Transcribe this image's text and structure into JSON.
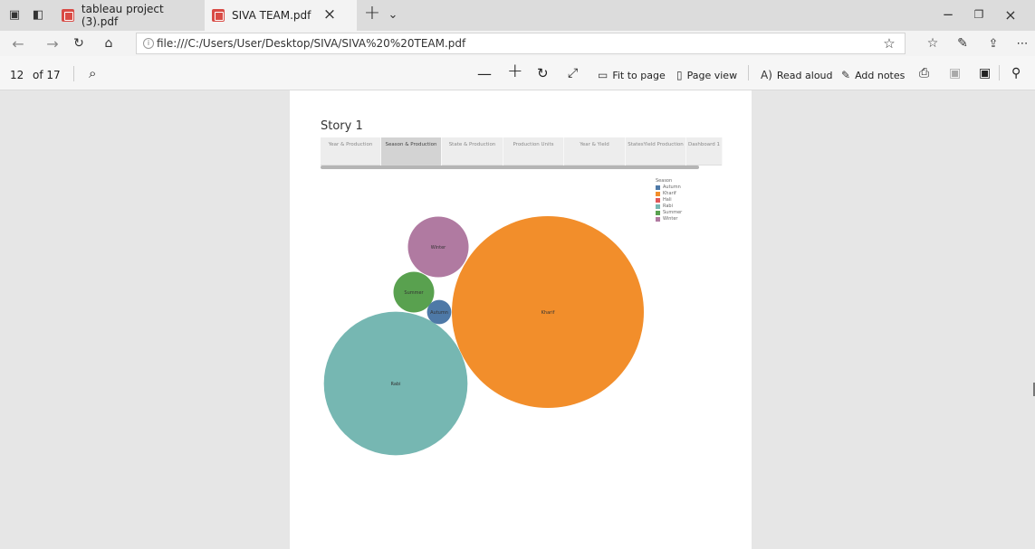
{
  "browser": {
    "tabs": [
      {
        "label": "tableau project (3).pdf"
      },
      {
        "label": "SIVA TEAM.pdf"
      }
    ],
    "url": "file:///C:/Users/User/Desktop/SIVA/SIVA%20%20TEAM.pdf"
  },
  "pdf_toolbar": {
    "page_current": "12",
    "page_total": "of 17",
    "fit_to_page": "Fit to page",
    "page_view": "Page view",
    "read_aloud": "Read aloud",
    "add_notes": "Add notes"
  },
  "story": {
    "title": "Story 1",
    "tabs": [
      "Year & Production",
      "Season & Production",
      "State & Production",
      "Production Units",
      "Year & Yield",
      "StatesYield Production",
      "Dashboard 1"
    ]
  },
  "legend": {
    "title": "Season",
    "items": [
      {
        "name": "Autumn",
        "color": "#4e79a7"
      },
      {
        "name": "Kharif",
        "color": "#f28e2b"
      },
      {
        "name": "Hali",
        "color": "#e15759"
      },
      {
        "name": "Rabi",
        "color": "#76b7b2"
      },
      {
        "name": "Summer",
        "color": "#59a14f"
      },
      {
        "name": "Winter",
        "color": "#b07aa1"
      }
    ]
  },
  "chart_data": {
    "type": "bubble",
    "series": [
      {
        "name": "Kharif",
        "value": 100,
        "color": "#f28e2b"
      },
      {
        "name": "Rabi",
        "value": 56,
        "color": "#76b7b2"
      },
      {
        "name": "Winter",
        "value": 10,
        "color": "#b07aa1"
      },
      {
        "name": "Summer",
        "value": 4.5,
        "color": "#59a14f"
      },
      {
        "name": "Autumn",
        "value": 1.6,
        "color": "#4e79a7"
      }
    ]
  }
}
